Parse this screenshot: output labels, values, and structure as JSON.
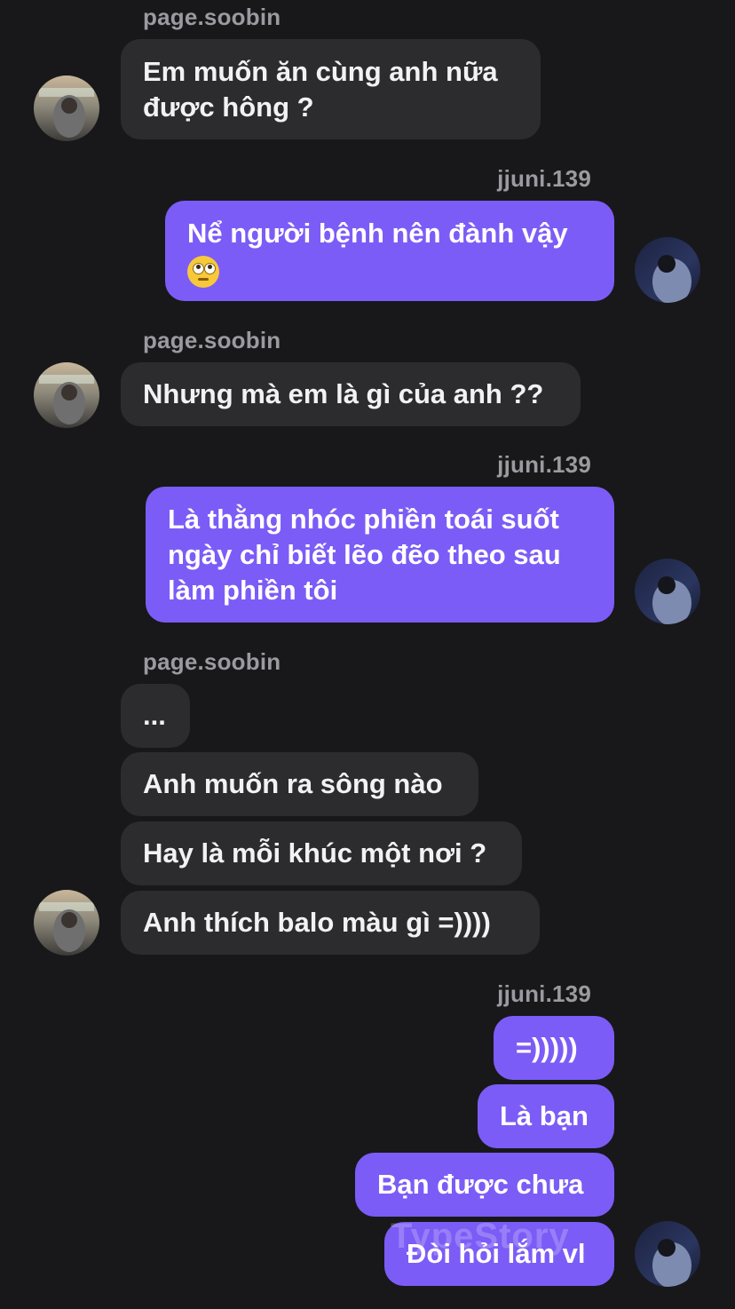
{
  "senders": {
    "other": "page.soobin",
    "me": "jjuni.139"
  },
  "messages": {
    "m1": "Em muốn ăn cùng anh nữa",
    "m1b": "được hông ?",
    "m2": "Nể người bệnh nên đành vậy",
    "m2_emoji": "face-with-rolling-eyes",
    "m3": "Nhưng mà em là gì của anh ??",
    "m4a": "Là thằng nhóc phiền toái suốt",
    "m4b": "ngày chỉ biết lẽo đẽo theo sau",
    "m4c": "làm phiền tôi",
    "m5": "...",
    "m6": "Anh muốn ra sông nào",
    "m7": "Hay là mỗi khúc một nơi ?",
    "m8": "Anh thích balo màu gì =))))",
    "m9": "=)))))",
    "m10": "Là bạn",
    "m11": "Bạn được chưa",
    "m12": "Đòi hỏi lắm vl"
  },
  "watermark": "TypeStory",
  "colors": {
    "background": "#18181a",
    "incoming_bubble": "#2c2c2f",
    "outgoing_bubble": "#7c5cf6",
    "sender_name": "#9a9aa0"
  }
}
